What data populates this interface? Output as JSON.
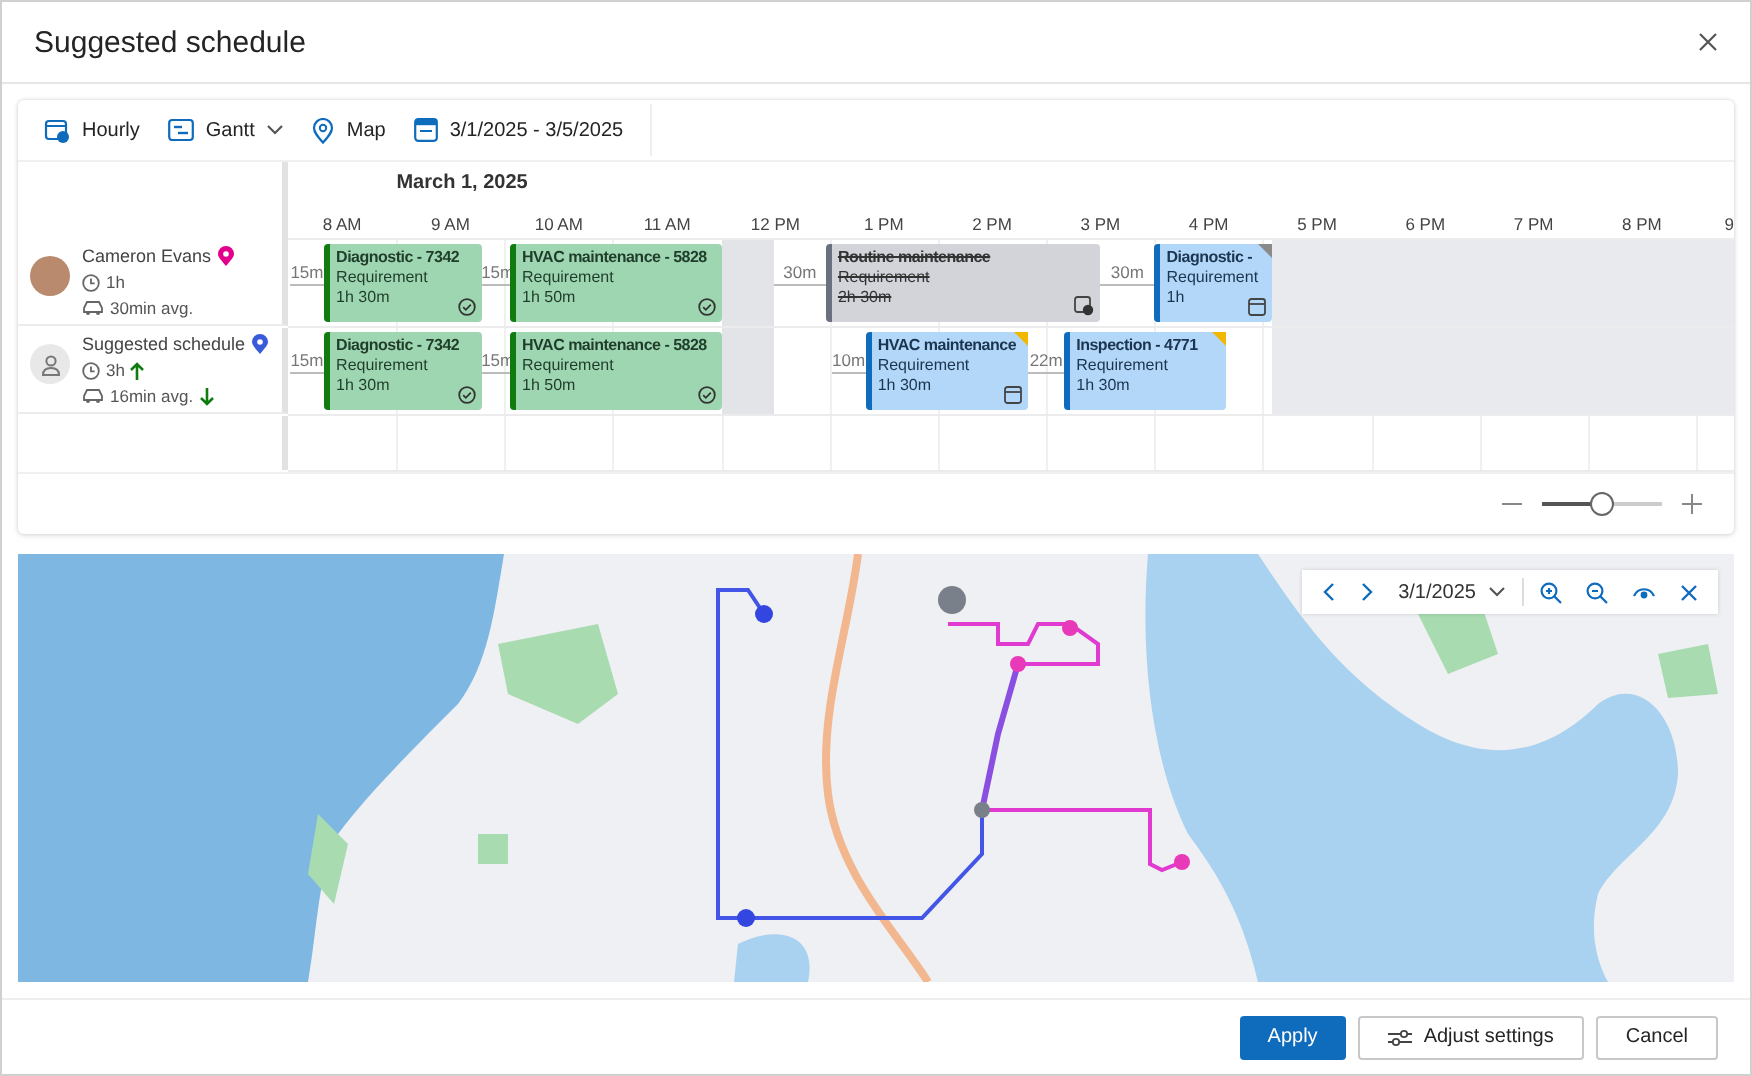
{
  "dialog": {
    "title": "Suggested schedule"
  },
  "toolbar": [
    {
      "label": "Hourly",
      "dropdown": false
    },
    {
      "label": "Gantt",
      "dropdown": true
    },
    {
      "label": "Map",
      "dropdown": false
    },
    {
      "label": "3/1/2025 - 3/5/2025",
      "dropdown": false
    }
  ],
  "gantt": {
    "date": "March 1, 2025",
    "hours": [
      "8 AM",
      "9 AM",
      "10 AM",
      "11 AM",
      "12 PM",
      "1 PM",
      "2 PM",
      "3 PM",
      "4 PM",
      "5 PM",
      "6 PM",
      "7 PM",
      "8 PM",
      "9"
    ],
    "rows": [
      {
        "name": "Cameron Evans",
        "kind": "photo",
        "color": "#e3008c",
        "work": "1h",
        "work_up": false,
        "travel": "30min avg.",
        "travel_down": false,
        "items": [
          {
            "kind": "travel",
            "label": "15m"
          },
          {
            "kind": "scheduled",
            "title": "Diagnostic - 7342",
            "subtitle": "Requirement",
            "duration": "1h 30m"
          },
          {
            "kind": "travel",
            "label": "15m"
          },
          {
            "kind": "scheduled",
            "title": "HVAC maintenance - 5828",
            "subtitle": "Requirement",
            "duration": "1h 50m"
          },
          {
            "kind": "break"
          },
          {
            "kind": "travel",
            "label": "30m"
          },
          {
            "kind": "removed",
            "title": "Routine maintenance",
            "subtitle": "Requirement",
            "duration": "2h 30m"
          },
          {
            "kind": "travel",
            "label": "30m"
          },
          {
            "kind": "suggested",
            "title": "Diagnostic -",
            "subtitle": "Requirement",
            "duration": "1h",
            "color": "#8a8a8a"
          }
        ]
      },
      {
        "name": "Suggested schedule",
        "kind": "generic",
        "color": "#3a5bd9",
        "work": "3h",
        "work_up": true,
        "travel": "16min avg.",
        "travel_down": true,
        "items": [
          {
            "kind": "travel",
            "label": "15m"
          },
          {
            "kind": "scheduled",
            "title": "Diagnostic - 7342",
            "subtitle": "Requirement",
            "duration": "1h 30m"
          },
          {
            "kind": "travel",
            "label": "15m"
          },
          {
            "kind": "scheduled",
            "title": "HVAC maintenance - 5828",
            "subtitle": "Requirement",
            "duration": "1h 50m"
          },
          {
            "kind": "break"
          },
          {
            "kind": "travel",
            "label": "10m"
          },
          {
            "kind": "suggested",
            "title": "HVAC maintenance",
            "subtitle": "Requirement",
            "duration": "1h 30m",
            "color": "#f2b800"
          },
          {
            "kind": "travel",
            "label": "22m"
          },
          {
            "kind": "suggested",
            "title": "Inspection - 4771",
            "subtitle": "Requirement",
            "duration": "1h 30m",
            "color": "#f2b800"
          }
        ]
      }
    ],
    "zoom": {
      "level": 0.5
    }
  },
  "map": {
    "date": "3/1/2025"
  },
  "buttons": [
    {
      "label": "Apply",
      "kind": "primary"
    },
    {
      "label": "Adjust settings",
      "kind": "settings"
    },
    {
      "label": "Cancel",
      "kind": "secondary"
    }
  ]
}
